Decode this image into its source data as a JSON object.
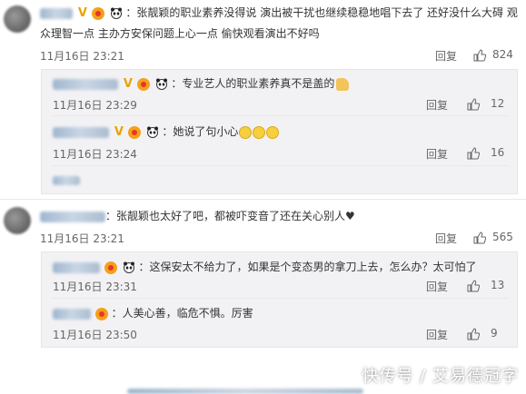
{
  "comments": [
    {
      "text_line1": "张靓颖的职业素养没得说 演出被干扰也继续稳稳地唱下去了 还好没什么大碍 观",
      "text_line2": "众理智一点 主办方安保问题上心一点 偷快观看演出不好吗",
      "date": "11月16日 23:21",
      "reply_label": "回复",
      "likes": "824",
      "replies": [
        {
          "text": "专业艺人的职业素养真不是盖的",
          "date": "11月16日 23:29",
          "reply_label": "回复",
          "likes": "12"
        },
        {
          "text": "她说了句小心",
          "date": "11月16日 23:24",
          "reply_label": "回复",
          "likes": "16"
        }
      ]
    },
    {
      "text": "张靓颖也太好了吧，都被吓变音了还在关心别人♥",
      "date": "11月16日 23:21",
      "reply_label": "回复",
      "likes": "565",
      "replies": [
        {
          "text": "这保安太不给力了，如果是个变态男的拿刀上去，怎么办？太可怕了",
          "date": "11月16日 23:31",
          "reply_label": "回复",
          "likes": "13"
        },
        {
          "text": "人美心善，临危不惧。厉害",
          "date": "11月16日 23:50",
          "reply_label": "回复",
          "likes": "9"
        }
      ]
    }
  ],
  "watermark": "快传号 / 艾易德冠字",
  "colors": {
    "badge": "#f4a11a",
    "reply_bg": "#f2f2f5",
    "vip": "#e8a300"
  }
}
